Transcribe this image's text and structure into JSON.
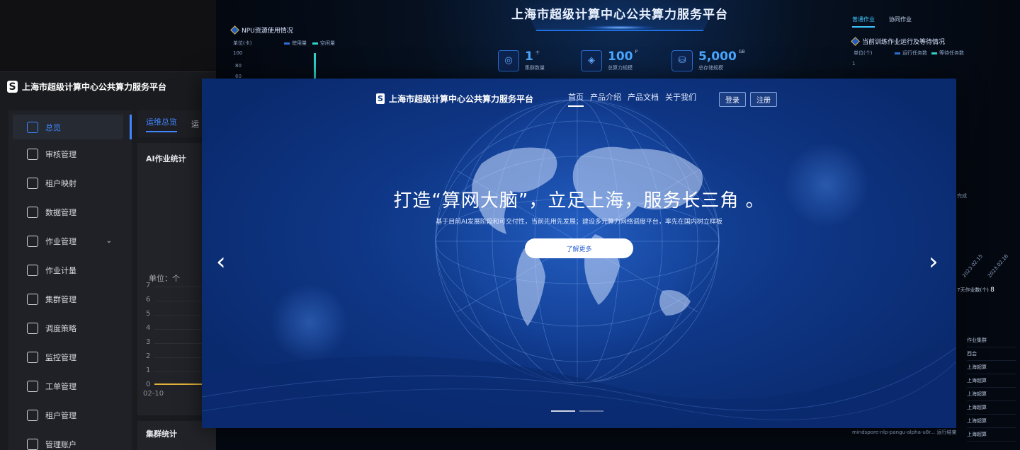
{
  "dashboard": {
    "title": "上海市超级计算中心公共算力服务平台",
    "npu_panel": {
      "title": "NPU资源使用情况",
      "unit": "单位(卡)",
      "legend": [
        "使用量",
        "空闲量"
      ],
      "yticks": [
        "100",
        "80",
        "60"
      ]
    },
    "kpis": [
      {
        "value": "1",
        "unit": "个",
        "label": "集群数量",
        "icon": "cluster-icon"
      },
      {
        "value": "100",
        "unit": "P",
        "label": "总算力规模",
        "icon": "compute-icon"
      },
      {
        "value": "5,000",
        "unit": "GB",
        "label": "总存储规模",
        "icon": "storage-icon"
      }
    ],
    "right_tabs": [
      "普通作业",
      "协同作业"
    ],
    "queue_panel": {
      "title": "当前训练作业运行及等待情况",
      "unit": "单位(个)",
      "legend": [
        "运行任务数",
        "等待任务数"
      ],
      "ytick": "1"
    },
    "side_fragments": [
      "完成",
      "2023.02.15",
      "2023.02.16",
      "7天作业数(个)",
      "8",
      "作业集群",
      "西会",
      "上海超算",
      "上海超算",
      "上海超算",
      "上海超算",
      "上海超算",
      "上海超算"
    ],
    "footer_text": "mindspore-nlp-pangu-alpha-u8r...  运行结束",
    "colors": {
      "accent": "#3fc4ff",
      "kpi": "#4aa7ff"
    }
  },
  "admin": {
    "brand": "上海市超级计算中心公共算力服务平台",
    "nav": [
      {
        "label": "总览",
        "icon": "dashboard-grid-icon",
        "active": true
      },
      {
        "label": "审核管理",
        "icon": "audit-icon"
      },
      {
        "label": "租户映射",
        "icon": "tenant-map-icon"
      },
      {
        "label": "数据管理",
        "icon": "data-icon"
      },
      {
        "label": "作业管理",
        "icon": "job-icon",
        "expandable": true
      },
      {
        "label": "作业计量",
        "icon": "metering-icon"
      },
      {
        "label": "集群管理",
        "icon": "cluster-icon"
      },
      {
        "label": "调度策略",
        "icon": "schedule-icon"
      },
      {
        "label": "监控管理",
        "icon": "monitor-icon"
      },
      {
        "label": "工单管理",
        "icon": "ticket-icon"
      },
      {
        "label": "租户管理",
        "icon": "tenant-icon"
      },
      {
        "label": "管理账户",
        "icon": "account-icon"
      }
    ],
    "tabs": [
      "运维总览",
      "运"
    ],
    "card_title": "AI作业统计",
    "unit_label": "单位：个",
    "yticks": [
      "7",
      "6",
      "5",
      "4",
      "3",
      "2",
      "1",
      "0"
    ],
    "xtick": "02-10",
    "card2_title": "集群统计",
    "colors": {
      "accent": "#3f86ff",
      "line": "#e2b33a"
    }
  },
  "portal": {
    "brand": "上海市超级计算中心公共算力服务平台",
    "menu": [
      "首页",
      "产品介绍",
      "产品文档",
      "关于我们"
    ],
    "login": "登录",
    "register": "注册",
    "headline": "打造“算网大脑”，立足上海，服务长三角 。",
    "subtitle": "基于目前AI发展阶段和可交付性，当前先用先发展；建设多元算力网络调度平台，率先在国内树立样板",
    "cta": "了解更多",
    "prev": "‹",
    "next": "›",
    "slides": 2,
    "active_slide": 0,
    "colors": {
      "bg": "#0f3787",
      "cta_text": "#2a62d0"
    }
  }
}
